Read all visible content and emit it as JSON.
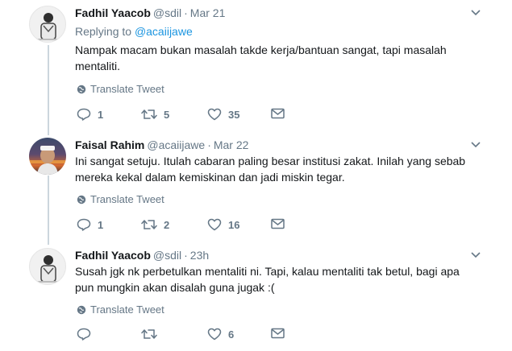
{
  "tweets": [
    {
      "name": "Fadhil Yaacob",
      "handle": "@sdil",
      "separator": "·",
      "time": "Mar 21",
      "replying_label": "Replying to",
      "replying_to": "@acaiijawe",
      "text": "Nampak macam bukan masalah takde kerja/bantuan sangat, tapi masalah mentaliti.",
      "translate": "Translate Tweet",
      "replies": "1",
      "retweets": "5",
      "likes": "35"
    },
    {
      "name": "Faisal Rahim",
      "handle": "@acaiijawe",
      "separator": "·",
      "time": "Mar 22",
      "text": "Ini sangat setuju. Itulah cabaran paling besar institusi zakat. Inilah yang sebab mereka kekal dalam kemiskinan dan jadi miskin tegar.",
      "translate": "Translate Tweet",
      "replies": "1",
      "retweets": "2",
      "likes": "16"
    },
    {
      "name": "Fadhil Yaacob",
      "handle": "@sdil",
      "separator": "·",
      "time": "23h",
      "text": "Susah jgk nk perbetulkan mentaliti ni. Tapi, kalau mentaliti tak betul, bagi apa pun mungkin akan disalah guna jugak :(",
      "translate": "Translate Tweet",
      "replies": "",
      "retweets": "",
      "likes": "6"
    }
  ],
  "icons": {
    "reply": "reply-icon",
    "retweet": "retweet-icon",
    "like": "heart-icon",
    "message": "envelope-icon",
    "translate": "globe-icon",
    "more": "chevron-down-icon"
  },
  "colors": {
    "link": "#1b95e0",
    "muted": "#657786",
    "thread_line": "#ccd6dd"
  }
}
